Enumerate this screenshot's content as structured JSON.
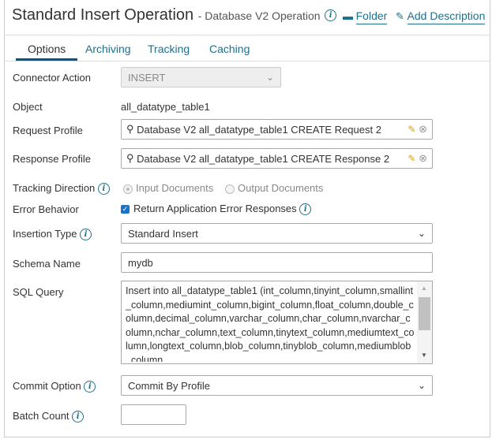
{
  "header": {
    "title": "Standard Insert Operation",
    "subtitle": "- Database V2 Operation",
    "folder_label": "Folder",
    "add_description_label": "Add Description"
  },
  "tabs": [
    {
      "label": "Options"
    },
    {
      "label": "Archiving"
    },
    {
      "label": "Tracking"
    },
    {
      "label": "Caching"
    }
  ],
  "form": {
    "connector_action": {
      "label": "Connector Action",
      "value": "INSERT"
    },
    "object": {
      "label": "Object",
      "value": "all_datatype_table1"
    },
    "request_profile": {
      "label": "Request Profile",
      "value": "Database V2 all_datatype_table1 CREATE Request 2"
    },
    "response_profile": {
      "label": "Response Profile",
      "value": "Database V2 all_datatype_table1 CREATE Response 2"
    },
    "tracking_direction": {
      "label": "Tracking Direction",
      "options": [
        "Input Documents",
        "Output Documents"
      ]
    },
    "error_behavior": {
      "label": "Error Behavior",
      "checkbox_label": "Return Application Error Responses",
      "checked": true
    },
    "insertion_type": {
      "label": "Insertion Type",
      "value": "Standard Insert"
    },
    "schema_name": {
      "label": "Schema Name",
      "value": "mydb"
    },
    "sql_query": {
      "label": "SQL Query",
      "value": "Insert into all_datatype_table1 (int_column,tinyint_column,smallint_column,mediumint_column,bigint_column,float_column,double_column,decimal_column,varchar_column,char_column,nvarchar_column,nchar_column,text_column,tinytext_column,mediumtext_column,longtext_column,blob_column,tinyblob_column,mediumblob_column"
    },
    "commit_option": {
      "label": "Commit Option",
      "value": "Commit By Profile"
    },
    "batch_count": {
      "label": "Batch Count",
      "value": ""
    }
  }
}
